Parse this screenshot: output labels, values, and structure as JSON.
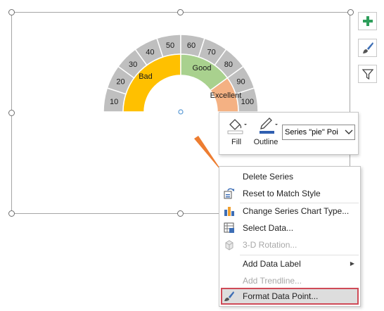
{
  "gauge": {
    "ticks": [
      "10",
      "20",
      "30",
      "40",
      "50",
      "60",
      "70",
      "80",
      "90",
      "100"
    ],
    "segments": [
      {
        "label": "Bad",
        "color": "#ffc000"
      },
      {
        "label": "Good",
        "color": "#a9d18e"
      },
      {
        "label": "Excellent",
        "color": "#f4b183"
      }
    ],
    "scale_color": "#bfbfbf",
    "pointer_color": "#ed7d31"
  },
  "side_buttons": [
    {
      "name": "chart-elements",
      "icon": "plus-icon"
    },
    {
      "name": "chart-styles",
      "icon": "paintbrush-icon"
    },
    {
      "name": "chart-filters",
      "icon": "funnel-icon"
    }
  ],
  "mini_toolbar": {
    "fill_label": "Fill",
    "outline_label": "Outline",
    "series_select_value": "Series \"pie\" Poi"
  },
  "context_menu": {
    "items": [
      {
        "label": "Delete Series",
        "icon": "",
        "disabled": false
      },
      {
        "label": "Reset to Match Style",
        "icon": "reset-style-icon",
        "disabled": false
      },
      {
        "label": "Change Series Chart Type...",
        "icon": "bar-chart-icon",
        "disabled": false
      },
      {
        "label": "Select Data...",
        "icon": "select-data-icon",
        "disabled": false
      },
      {
        "label": "3-D Rotation...",
        "icon": "cube-icon",
        "disabled": true
      },
      {
        "label": "Add Data Label",
        "icon": "",
        "disabled": false,
        "submenu": true
      },
      {
        "label": "Add Trendline...",
        "icon": "",
        "disabled": true
      },
      {
        "label": "Format Data Point...",
        "icon": "format-brush-icon",
        "disabled": false,
        "selected": true
      }
    ]
  }
}
